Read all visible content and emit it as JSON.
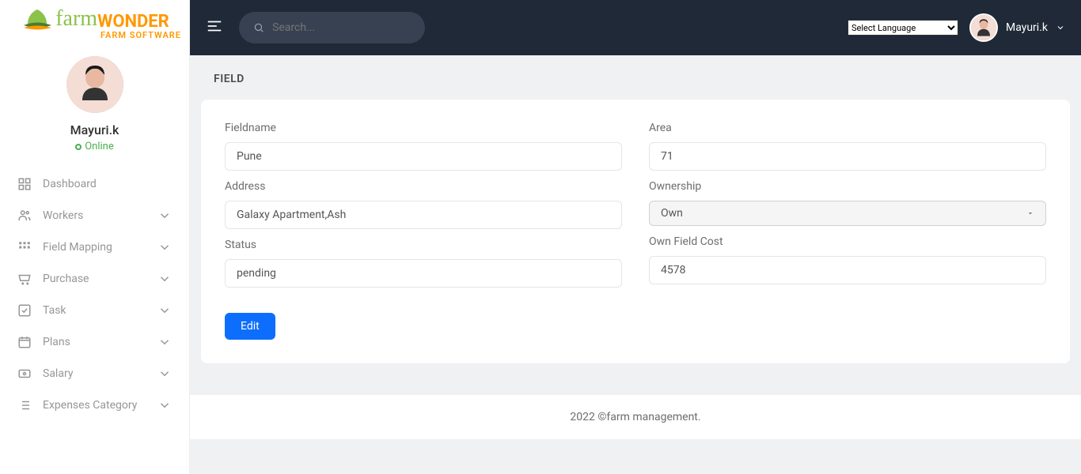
{
  "logo": {
    "p1": "farm",
    "p2": "WONDER",
    "sub": "FARM SOFTWARE"
  },
  "profile": {
    "name": "Mayuri.k",
    "status": "Online"
  },
  "nav": {
    "dashboard": "Dashboard",
    "workers": "Workers",
    "fieldmapping": "Field Mapping",
    "purchase": "Purchase",
    "task": "Task",
    "plans": "Plans",
    "salary": "Salary",
    "expenses": "Expenses Category"
  },
  "search": {
    "placeholder": "Search..."
  },
  "lang": "Select Language",
  "user": "Mayuri.k",
  "page": {
    "title": "FIELD"
  },
  "form": {
    "fieldname": {
      "label": "Fieldname",
      "value": "Pune"
    },
    "address": {
      "label": "Address",
      "value": "Galaxy Apartment,Ash"
    },
    "status": {
      "label": "Status",
      "value": "pending"
    },
    "area": {
      "label": "Area",
      "value": "71"
    },
    "ownership": {
      "label": "Ownership",
      "value": "Own"
    },
    "ownfieldcost": {
      "label": "Own Field Cost",
      "value": "4578"
    },
    "editBtn": "Edit"
  },
  "footer": "2022 ©farm management."
}
